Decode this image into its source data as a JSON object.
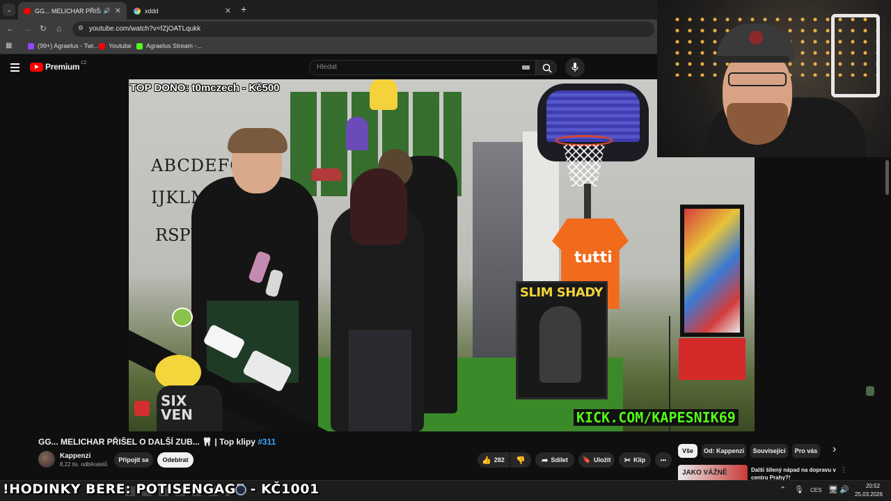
{
  "browser": {
    "tabs": [
      {
        "title": "GG... MELICHAR PŘIŠEL O D",
        "fav_color": "#ff0000"
      },
      {
        "title": "xddd",
        "fav_color": "#8e6cf0"
      }
    ],
    "new_tab": "+",
    "url": "youtube.com/watch?v=fZjOATLqukk",
    "bookmarks": [
      {
        "label": "(99+) Agraelus - Twi...",
        "fav_color": "#9146ff"
      },
      {
        "label": "Youtube",
        "fav_color": "#ff0000"
      },
      {
        "label": "Agraelus Stream -...",
        "fav_color": "#53fc18"
      }
    ]
  },
  "youtube": {
    "logo_text": "Premium",
    "logo_region": "CZ",
    "search_placeholder": "Hledat"
  },
  "video": {
    "overlay_top": "TOP DONO: t0mczech - Kč500",
    "overlay_bottom": "KICK.COM/KAPESNIK69",
    "poster_text": "SLIM SHADY",
    "wall_letters_1": "ABCDEFGH",
    "wall_letters_2": "IJKLMNOP",
    "wall_letters_3": "RSPU",
    "shirt_text": "tutti",
    "bag_text": "SIX VEN"
  },
  "details": {
    "title": "GG... MELICHAR PŘIŠEL O DALŠÍ ZUB... 🦷 | Top klipy",
    "hashtag": "#311",
    "channel_name": "Kappenzi",
    "subscribers": "8,22 tis. odběratelů",
    "join_label": "Připojit se",
    "subscribe_label": "Odebírat",
    "likes": "282",
    "share_label": "Sdílet",
    "save_label": "Uložit",
    "clip_label": "Klip",
    "more": "•••"
  },
  "sidebar": {
    "chips": [
      "Vše",
      "Od: Kappenzi",
      "Související",
      "Pro vás"
    ],
    "next": "›",
    "rec_title": "Další šílený nápad na dopravu v centru Prahy?!",
    "rec_thumb_text": "JAKO VÁŽNĚ"
  },
  "stream_ticker": "!HODINKY BERE: POTISENGAGE - KČ1001",
  "taskbar": {
    "lang": "CES",
    "time": "20:52",
    "date": "25.03.2026"
  }
}
